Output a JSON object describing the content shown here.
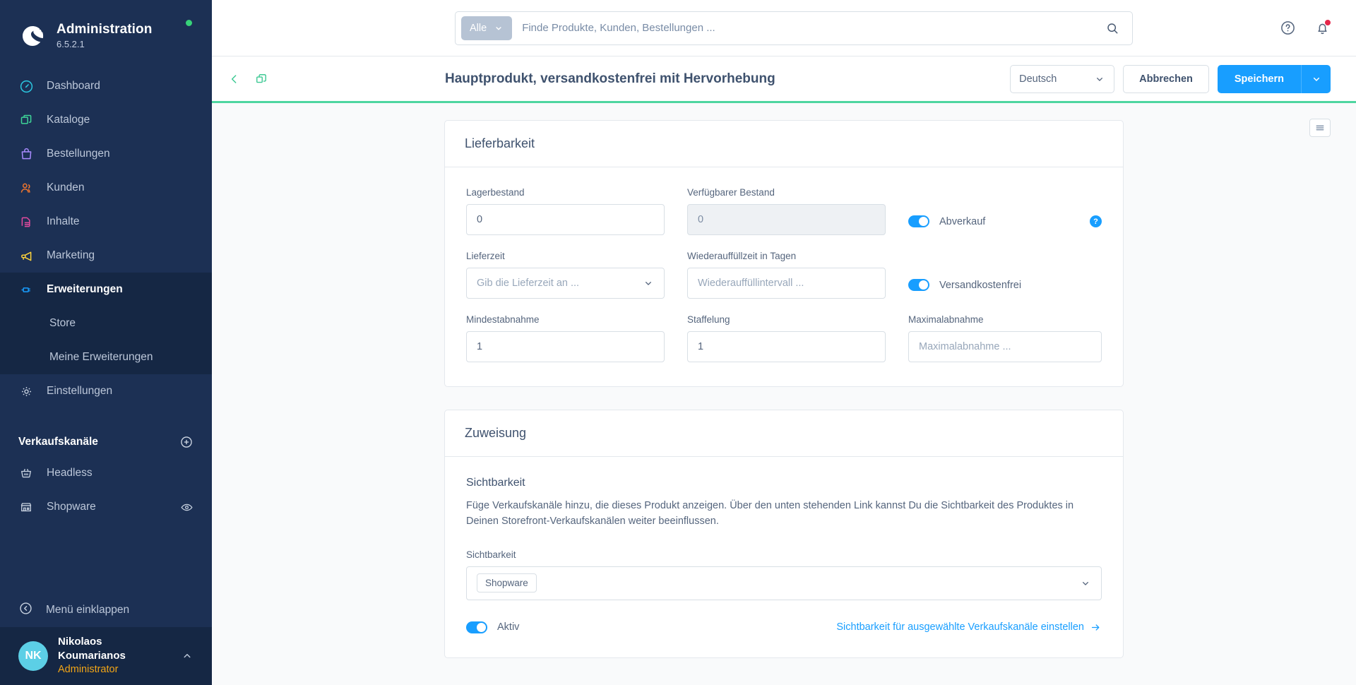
{
  "sidebar": {
    "brand": {
      "title": "Administration",
      "version": "6.5.2.1"
    },
    "nav": [
      {
        "label": "Dashboard",
        "icon": "dashboard-icon",
        "active": false
      },
      {
        "label": "Kataloge",
        "icon": "catalog-icon",
        "active": false
      },
      {
        "label": "Bestellungen",
        "icon": "orders-icon",
        "active": false
      },
      {
        "label": "Kunden",
        "icon": "customers-icon",
        "active": false
      },
      {
        "label": "Inhalte",
        "icon": "content-icon",
        "active": false
      },
      {
        "label": "Marketing",
        "icon": "marketing-icon",
        "active": false
      },
      {
        "label": "Erweiterungen",
        "icon": "extensions-icon",
        "active": true
      }
    ],
    "sub_items": [
      {
        "label": "Store"
      },
      {
        "label": "Meine Erweiterungen"
      }
    ],
    "settings": {
      "label": "Einstellungen",
      "icon": "gear-icon"
    },
    "sales_channels": {
      "title": "Verkaufskanäle",
      "add_label": "plus-circle-icon",
      "items": [
        {
          "label": "Headless",
          "icon": "basket-icon",
          "has_eye": false
        },
        {
          "label": "Shopware",
          "icon": "storefront-icon",
          "has_eye": true
        }
      ]
    },
    "collapse": {
      "label": "Menü einklappen",
      "icon": "chevron-left-circle-icon"
    },
    "user": {
      "initials": "NK",
      "name": "Nikolaos Koumarianos",
      "role": "Administrator"
    }
  },
  "topbar": {
    "search_scope": "Alle",
    "search_placeholder": "Finde Produkte, Kunden, Bestellungen ...",
    "search_value": "",
    "help_icon": "question-circle-icon",
    "notifications_icon": "bell-icon"
  },
  "product_header": {
    "back_icon": "chevron-left-icon",
    "duplicate_icon": "copy-icon",
    "title": "Hauptprodukt, versandkostenfrei mit Hervorhebung",
    "language": "Deutsch",
    "cancel_label": "Abbrechen",
    "save_label": "Speichern",
    "save_dropdown_icon": "chevron-down-icon"
  },
  "content": {
    "list_toggle_icon": "list-view-icon",
    "delivery_card": {
      "title": "Lieferbarkeit",
      "fields": {
        "stock": {
          "label": "Lagerbestand",
          "value": "0",
          "placeholder": ""
        },
        "available_stock": {
          "label": "Verfügbarer Bestand",
          "value": "0",
          "placeholder": "",
          "disabled": true
        },
        "delivery_time": {
          "label": "Lieferzeit",
          "value": "",
          "placeholder": "Gib die Lieferzeit an ..."
        },
        "restock_time": {
          "label": "Wiederauffüllzeit in Tagen",
          "value": "",
          "placeholder": "Wiederauffüllintervall ..."
        },
        "min_purchase": {
          "label": "Mindestabnahme",
          "value": "1",
          "placeholder": ""
        },
        "purchase_steps": {
          "label": "Staffelung",
          "value": "1",
          "placeholder": ""
        },
        "max_purchase": {
          "label": "Maximalabnahme",
          "value": "",
          "placeholder": "Maximalabnahme ..."
        }
      },
      "toggles": {
        "clearance_sale": {
          "label": "Abverkauf",
          "on": true,
          "help": "?"
        },
        "free_shipping": {
          "label": "Versandkostenfrei",
          "on": true
        }
      }
    },
    "assignment_card": {
      "title": "Zuweisung",
      "visibility_heading": "Sichtbarkeit",
      "visibility_description": "Füge Verkaufskanäle hinzu, die dieses Produkt anzeigen. Über den unten stehenden Link kannst Du die Sichtbarkeit des Produktes in Deinen Storefront-Verkaufskanälen weiter beeinflussen.",
      "visibility_label": "Sichtbarkeit",
      "visibility_chips": [
        "Shopware"
      ],
      "active_toggle": {
        "label": "Aktiv",
        "on": true
      },
      "visibility_link": "Sichtbarkeit für ausgewählte Verkaufskanäle einstellen"
    }
  },
  "colors": {
    "sidebar_bg": "#1c3054",
    "sidebar_active": "#152744",
    "accent_blue": "#189eff",
    "accent_green": "#4ed6a0",
    "role_orange": "#f2a516",
    "avatar": "#5ccfe6",
    "notification_red": "#e5264a"
  }
}
